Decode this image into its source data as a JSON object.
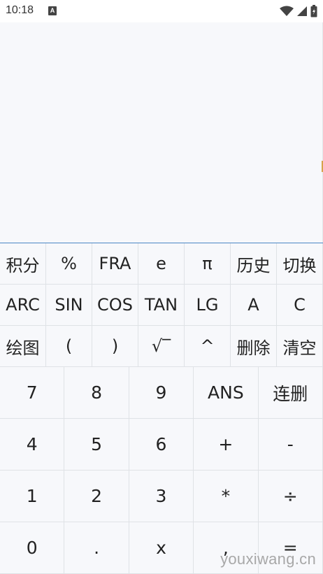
{
  "status_bar": {
    "time": "10:18",
    "notification_icon": "a-icon",
    "icons": [
      "wifi-icon",
      "signal-icon",
      "battery-icon"
    ]
  },
  "display": {
    "expression": "",
    "result": ""
  },
  "function_keys": [
    [
      "积分",
      "%",
      "FRA",
      "e",
      "π",
      "历史",
      "切换"
    ],
    [
      "ARC",
      "SIN",
      "COS",
      "TAN",
      "LG",
      "A",
      "C"
    ],
    [
      "绘图",
      "(",
      ")",
      "√‾",
      "^",
      "删除",
      "清空"
    ]
  ],
  "number_keys": [
    [
      "7",
      "8",
      "9",
      "ANS",
      "连删"
    ],
    [
      "4",
      "5",
      "6",
      "+",
      "-"
    ],
    [
      "1",
      "2",
      "3",
      "*",
      "÷"
    ],
    [
      "0",
      ".",
      "x",
      ",",
      "="
    ]
  ],
  "watermark": "youxiwang.cn",
  "colors": {
    "accent_line": "#4a86c5",
    "background": "#f7f8fb",
    "divider": "#dfe2e6"
  }
}
